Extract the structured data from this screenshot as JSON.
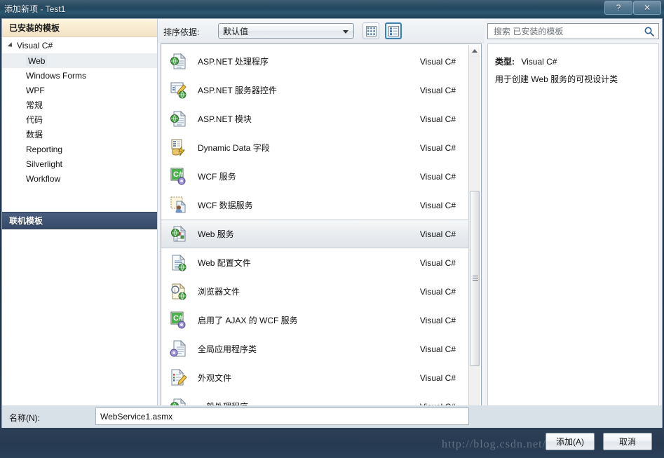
{
  "titlebar": {
    "title": "添加新项 - Test1",
    "help_label": "?",
    "close_label": "✕"
  },
  "sidebar": {
    "installed_header": "已安装的模板",
    "root": "Visual C#",
    "items": [
      {
        "label": "Web",
        "selected": true
      },
      {
        "label": "Windows Forms",
        "selected": false
      },
      {
        "label": "WPF",
        "selected": false
      },
      {
        "label": "常规",
        "selected": false
      },
      {
        "label": "代码",
        "selected": false
      },
      {
        "label": "数据",
        "selected": false
      },
      {
        "label": "Reporting",
        "selected": false
      },
      {
        "label": "Silverlight",
        "selected": false
      },
      {
        "label": "Workflow",
        "selected": false
      }
    ],
    "online_templates": "联机模板"
  },
  "toolbar": {
    "sort_label": "排序依据:",
    "sort_value": "默认值",
    "view_small_icon": "small-icons-view-icon",
    "view_large_icon": "large-icons-view-icon"
  },
  "list": {
    "items": [
      {
        "name": "ASP.NET 处理程序",
        "lang": "Visual C#",
        "icon": "web-page-file-icon",
        "selected": false
      },
      {
        "name": "ASP.NET 服务器控件",
        "lang": "Visual C#",
        "icon": "server-control-icon",
        "selected": false
      },
      {
        "name": "ASP.NET 模块",
        "lang": "Visual C#",
        "icon": "web-page-file-icon",
        "selected": false
      },
      {
        "name": "Dynamic Data 字段",
        "lang": "Visual C#",
        "icon": "dynamic-data-field-icon",
        "selected": false
      },
      {
        "name": "WCF 服务",
        "lang": "Visual C#",
        "icon": "csharp-service-icon",
        "selected": false
      },
      {
        "name": "WCF 数据服务",
        "lang": "Visual C#",
        "icon": "wcf-data-service-icon",
        "selected": false
      },
      {
        "name": "Web 服务",
        "lang": "Visual C#",
        "icon": "web-service-icon",
        "selected": true
      },
      {
        "name": "Web 配置文件",
        "lang": "Visual C#",
        "icon": "web-config-file-icon",
        "selected": false
      },
      {
        "name": "浏览器文件",
        "lang": "Visual C#",
        "icon": "browser-file-icon",
        "selected": false
      },
      {
        "name": "启用了 AJAX 的 WCF 服务",
        "lang": "Visual C#",
        "icon": "csharp-service-icon",
        "selected": false
      },
      {
        "name": "全局应用程序类",
        "lang": "Visual C#",
        "icon": "global-app-class-icon",
        "selected": false
      },
      {
        "name": "外观文件",
        "lang": "Visual C#",
        "icon": "skin-file-icon",
        "selected": false
      },
      {
        "name": "一般处理程序",
        "lang": "Visual C#",
        "icon": "web-page-file-icon",
        "selected": false
      }
    ]
  },
  "search": {
    "placeholder": "搜索 已安装的模板",
    "value": "",
    "icon": "search-icon"
  },
  "info": {
    "type_label": "类型:",
    "type_value": "Visual C#",
    "description": "用于创建 Web 服务的可视设计类"
  },
  "name_row": {
    "label": "名称(N):",
    "value": "WebService1.asmx"
  },
  "footer": {
    "add_label": "添加(A)",
    "cancel_label": "取消",
    "watermark": "http://blog.csdn.net/TheDanR"
  },
  "colors": {
    "titlebar": "#264a63",
    "installed_header": "#f7ead0",
    "online_bar": "#3f5474",
    "footer": "#263a51",
    "accent_blue": "#3c7fb1"
  }
}
